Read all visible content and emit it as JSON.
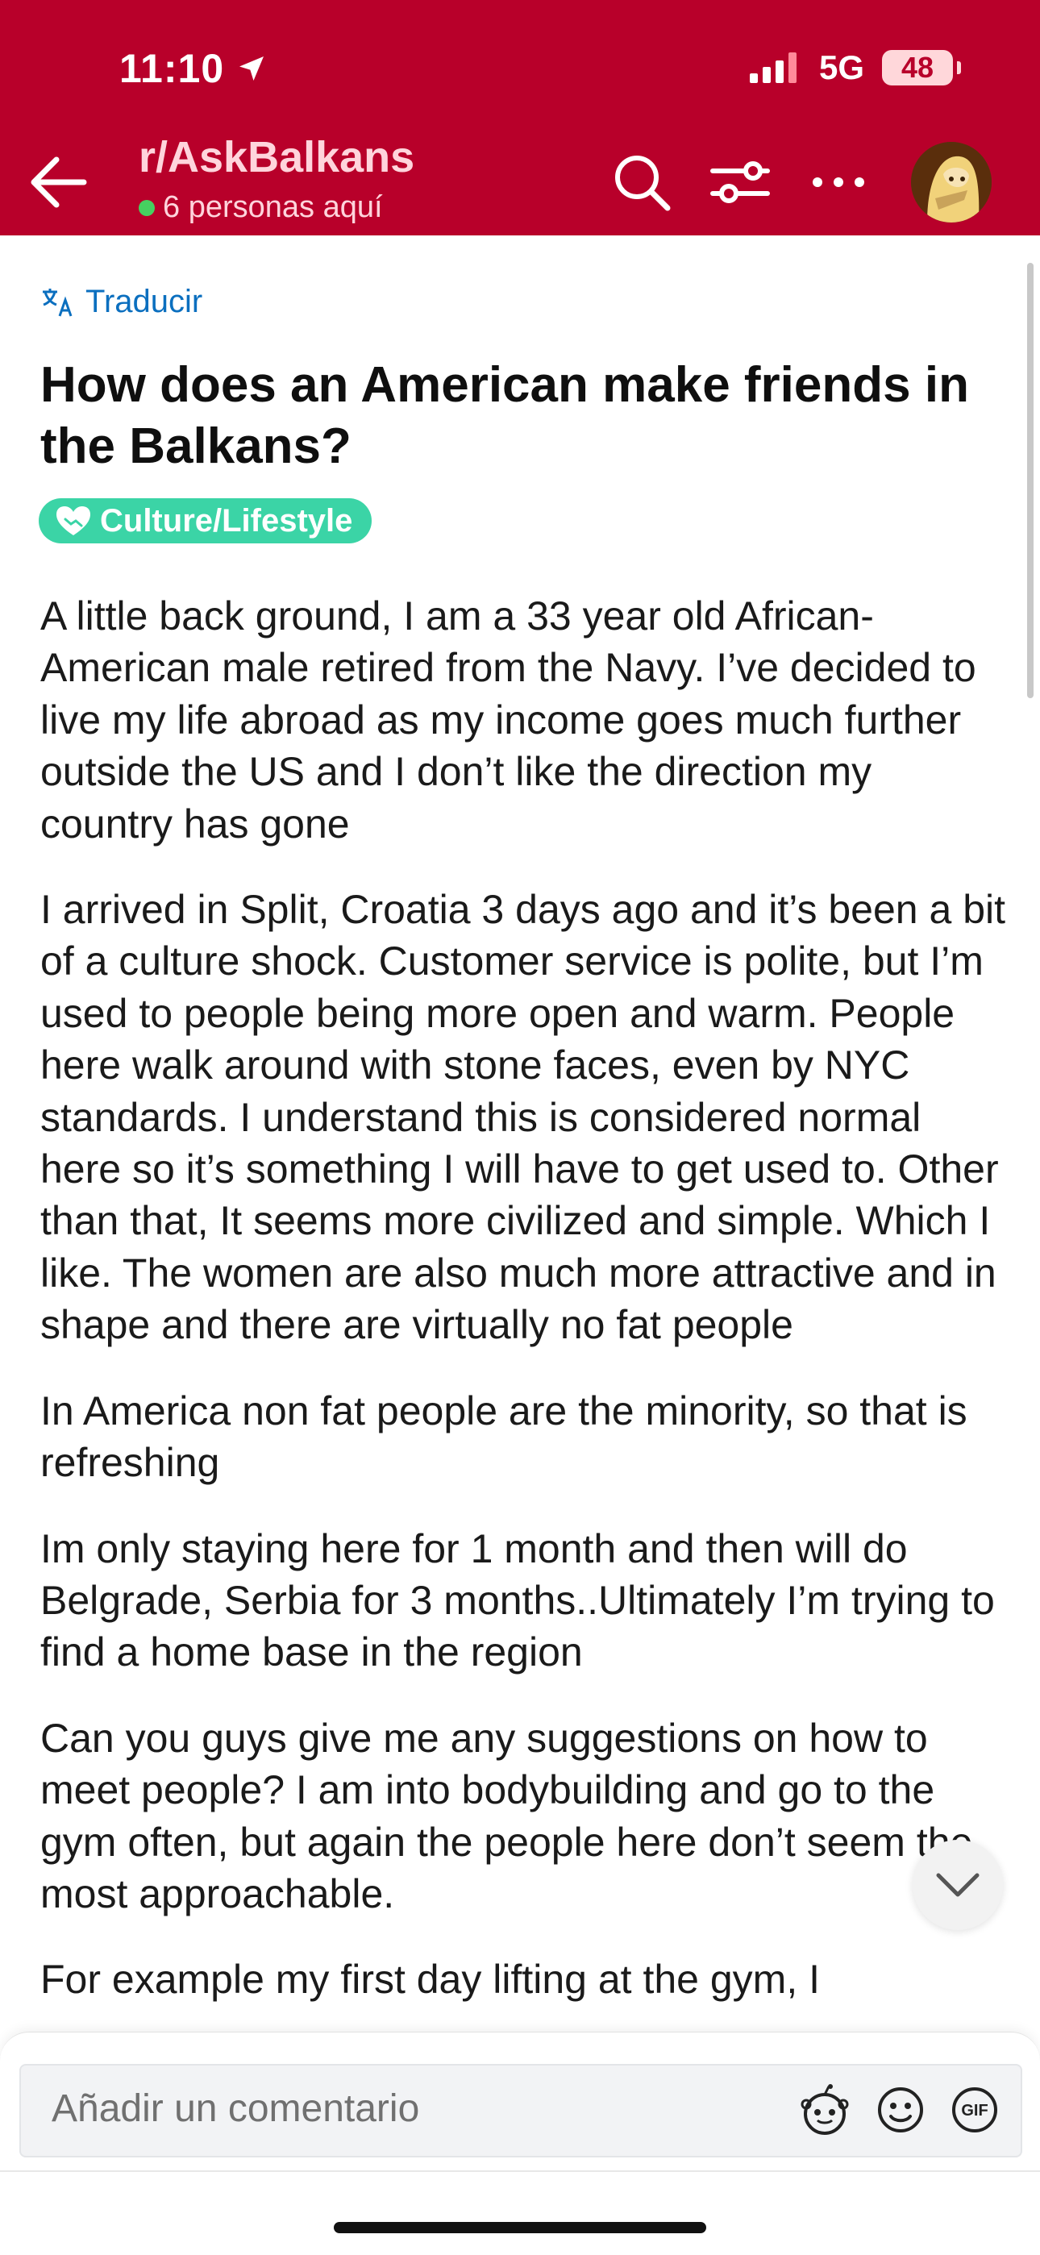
{
  "status_bar": {
    "time": "11:10",
    "network": "5G",
    "battery": "48"
  },
  "header": {
    "subreddit": "r/AskBalkans",
    "presence": "6 personas aquí"
  },
  "post": {
    "translate_label": "Traducir",
    "title": "How does an American make friends in the Balkans?",
    "flair": "Culture/Lifestyle",
    "paragraphs": [
      "A little back ground, I am a 33 year old African-American male retired from the Navy.   I’ve decided to live my life abroad as my income goes much further outside the US and I don’t like the direction my country has gone",
      "I arrived in Split, Croatia 3 days ago and it’s been a bit of a culture shock. Customer service is polite, but I’m used to people being more open and warm. People here walk around with stone faces, even by NYC standards. I understand this is considered normal here so it’s something I will have to get used to. Other than that, It seems more civilized and simple. Which I like. The women are also much more attractive and in shape and there are virtually no fat people",
      "In America non fat people are the minority, so that is refreshing",
      "Im only staying here for 1 month and then will do Belgrade, Serbia for 3 months..Ultimately I’m trying to find a home base in the region",
      "Can you guys give me any suggestions on how to meet people? I am into bodybuilding and go to the gym often, but again the people here don’t seem the most approachable.",
      "For example my first day lifting at the gym, I"
    ]
  },
  "composer": {
    "placeholder": "Añadir un comentario",
    "gif_label": "GIF"
  },
  "colors": {
    "header_bg": "#b8002a",
    "flair_bg": "#3bd4a6",
    "link_blue": "#0b6fbf"
  }
}
